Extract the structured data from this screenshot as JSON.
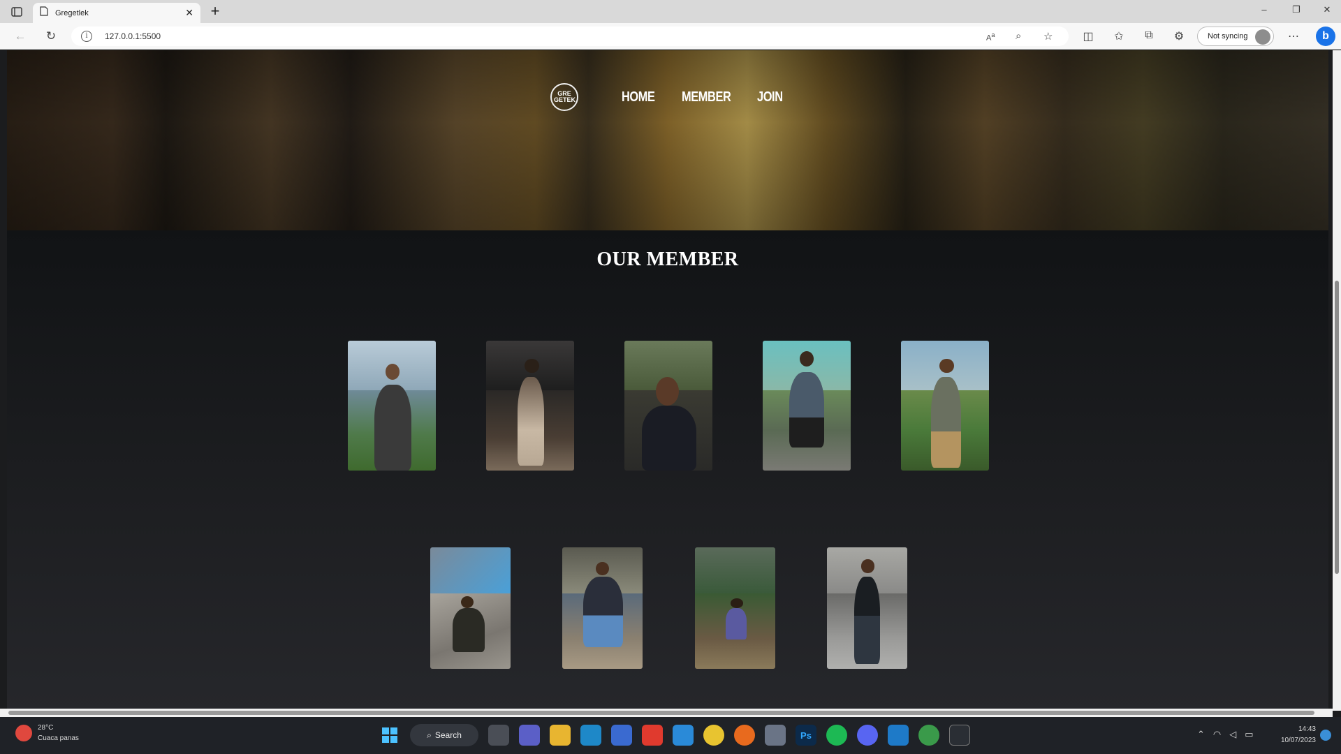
{
  "browser": {
    "tab_title": "Gregetlek",
    "url": "127.0.0.1:5500",
    "sync_label": "Not syncing",
    "window_controls": [
      "–",
      "❐",
      "✕"
    ]
  },
  "site": {
    "logo_text": "GRE GETEK",
    "nav": {
      "home": "HOME",
      "member": "MEMBER",
      "join": "JOIN"
    },
    "section_title": "OUR MEMBER"
  },
  "members_row1": [
    "member-1",
    "member-2",
    "member-3",
    "member-4",
    "member-5"
  ],
  "members_row2": [
    "member-6",
    "member-7",
    "member-8",
    "member-9"
  ],
  "taskbar": {
    "weather_temp": "28°C",
    "weather_desc": "Cuaca panas",
    "search_label": "Search",
    "time": "14:43",
    "date": "10/07/2023"
  }
}
